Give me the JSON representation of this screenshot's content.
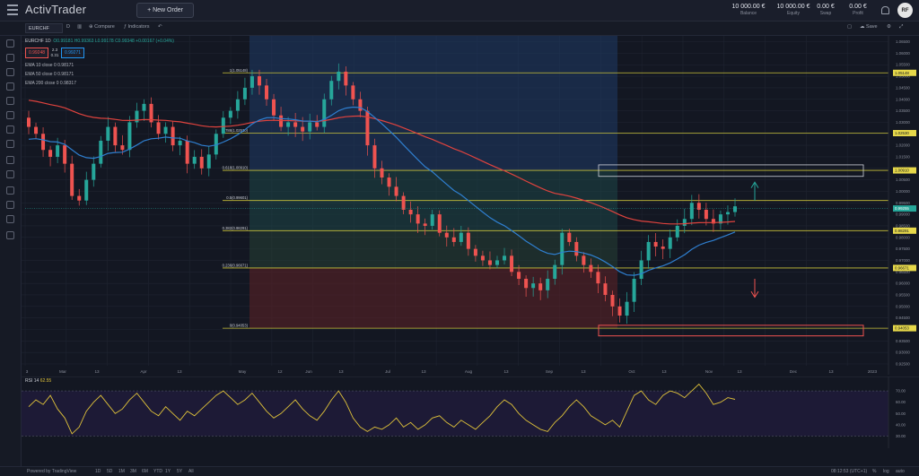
{
  "app": {
    "logo": "ActivTrader",
    "new_order_label": "+ New Order"
  },
  "account": {
    "balance": {
      "value": "10 000.00 €",
      "label": "Balance"
    },
    "equity": {
      "value": "10 000.00 €",
      "label": "Equity"
    },
    "swap": {
      "value": "0.00 €",
      "label": "Swap"
    },
    "profit": {
      "value": "0.00 €",
      "label": "Profit"
    },
    "user_initials": "RF"
  },
  "toolbar": {
    "symbol": "EURCHF",
    "interval": "D",
    "compare_label": "Compare",
    "indicators_label": "Indicators",
    "save_label": "Save"
  },
  "legend": {
    "title": "EURCHF  1D",
    "ohlc": "O0.99181 H0.99363 L0.99178 C0.99348 +0.00167 (+0.04%)",
    "sell_price": "0.99248",
    "buy_price": "0.99271",
    "spread_top": "2.3",
    "spread_bottom": "0.31",
    "ma1": "EMA 10 close 0  0.98171",
    "ma2": "EMA 50 close 0  0.98171",
    "ma3": "EMA 200 close 0  0.98317"
  },
  "fib_levels": [
    {
      "ratio_label": "1(1.05148)",
      "price": 1.05148,
      "tag": "1.05148"
    },
    {
      "ratio_label": "0.786(1.02530)",
      "price": 1.0253,
      "tag": "1.02530"
    },
    {
      "ratio_label": "0.618(1.00910)",
      "price": 1.0091,
      "tag": "1.00910"
    },
    {
      "ratio_label": "0.5(0.99601)",
      "price": 0.99601,
      "tag": ""
    },
    {
      "ratio_label": "0.382(0.98291)",
      "price": 0.98291,
      "tag": "0.98291"
    },
    {
      "ratio_label": "0.236(0.96671)",
      "price": 0.96671,
      "tag": "0.96671"
    },
    {
      "ratio_label": "0(0.94053)",
      "price": 0.94053,
      "tag": "0.94053"
    }
  ],
  "current_price_tag": "0.99255",
  "price_axis_ticks": [
    "1.06500",
    "1.06000",
    "1.05500",
    "1.05000",
    "1.04500",
    "1.04000",
    "1.03500",
    "1.03000",
    "1.02500",
    "1.02000",
    "1.01500",
    "1.01000",
    "1.00500",
    "1.00000",
    "0.99500",
    "0.99000",
    "0.98500",
    "0.98000",
    "0.97500",
    "0.97000",
    "0.96500",
    "0.96000",
    "0.95500",
    "0.95000",
    "0.94500",
    "0.94000",
    "0.93500",
    "0.93000",
    "0.92500"
  ],
  "time_axis_labels": [
    "3",
    "Mar",
    "13",
    "Apr",
    "13",
    "May",
    "12",
    "Jun",
    "13",
    "Jul",
    "13",
    "Aug",
    "13",
    "Sep",
    "13",
    "Oct",
    "13",
    "Nov",
    "13",
    "Dec",
    "13",
    "2023"
  ],
  "rsi": {
    "label": "RSI 14",
    "value": "62.55",
    "ticks": [
      "70.00",
      "60.00",
      "50.00",
      "40.00",
      "30.00"
    ]
  },
  "bottom": {
    "powered": "Powered by TradingView",
    "timeframes": [
      "1D",
      "5D",
      "1M",
      "3M",
      "6M",
      "YTD",
      "1Y",
      "5Y",
      "All"
    ],
    "clock": "08:12:53 (UTC+1)",
    "percent": "%",
    "log": "log",
    "auto": "auto"
  },
  "colors": {
    "up": "#26a69a",
    "down": "#ef5350",
    "ema_blue": "#2f7fd0",
    "ema_red": "#e0433e",
    "fib_line": "#c9c23a",
    "rsi_line": "#e0c33a",
    "bg": "#131722"
  },
  "chart_data": {
    "type": "line",
    "series": [
      {
        "name": "EURCHF",
        "values": [
          1.028,
          1.025,
          1.018,
          1.015,
          1.02,
          1.012,
          0.998,
          0.996,
          1.005,
          1.012,
          1.022,
          1.028,
          1.02,
          1.018,
          1.03,
          1.035,
          1.038,
          1.03,
          1.025,
          1.028,
          1.02,
          1.022,
          1.012,
          1.015,
          1.01,
          1.016,
          1.025,
          1.032,
          1.035,
          1.04,
          1.045,
          1.05,
          1.046,
          1.04,
          1.033,
          1.028,
          1.03,
          1.028,
          1.026,
          1.03,
          1.028,
          1.04,
          1.048,
          1.052,
          1.046,
          1.04,
          1.035,
          1.02,
          1.01,
          1.006,
          1.002,
          0.998,
          0.992,
          0.99,
          0.986,
          0.985,
          0.99,
          0.982,
          0.98,
          0.978,
          0.982,
          0.975,
          0.972,
          0.97,
          0.968,
          0.97,
          0.972,
          0.965,
          0.962,
          0.958,
          0.96,
          0.957,
          0.962,
          0.968,
          0.982,
          0.978,
          0.972,
          0.968,
          0.965,
          0.96,
          0.955,
          0.95,
          0.946,
          0.952,
          0.962,
          0.97,
          0.978,
          0.976,
          0.975,
          0.98,
          0.985,
          0.988,
          0.995,
          0.992,
          0.988,
          0.986,
          0.99,
          0.991,
          0.9935
        ]
      },
      {
        "name": "EMA 50",
        "values": []
      },
      {
        "name": "EMA 200",
        "values": []
      }
    ],
    "ylim": [
      0.925,
      1.066
    ],
    "rsi_values": [
      56,
      62,
      58,
      66,
      54,
      46,
      32,
      38,
      52,
      60,
      66,
      58,
      50,
      54,
      62,
      68,
      60,
      52,
      48,
      56,
      50,
      44,
      52,
      48,
      54,
      60,
      66,
      70,
      64,
      58,
      62,
      68,
      60,
      52,
      46,
      50,
      56,
      62,
      54,
      48,
      44,
      52,
      62,
      70,
      60,
      46,
      38,
      34,
      38,
      36,
      40,
      46,
      38,
      42,
      36,
      40,
      46,
      48,
      42,
      38,
      44,
      40,
      36,
      42,
      48,
      56,
      62,
      58,
      50,
      44,
      40,
      36,
      34,
      42,
      48,
      56,
      62,
      56,
      48,
      44,
      40,
      44,
      38,
      52,
      66,
      70,
      62,
      58,
      66,
      70,
      68,
      64,
      70,
      76,
      68,
      58,
      60,
      64,
      62.55
    ]
  }
}
